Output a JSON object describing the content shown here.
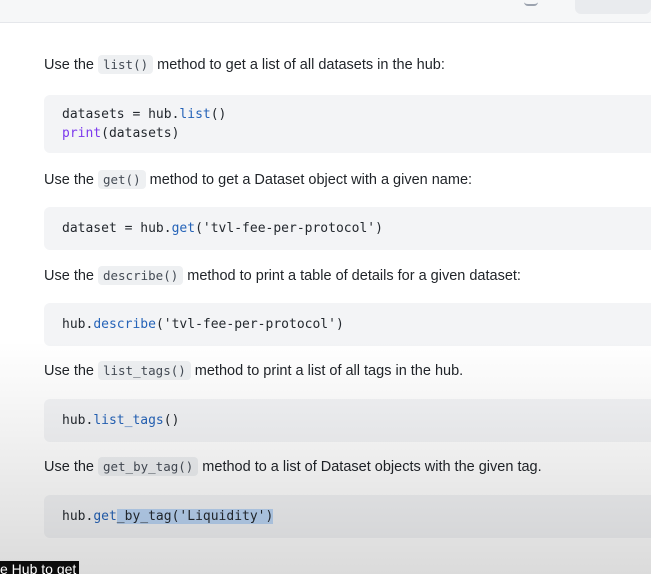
{
  "doc": {
    "sections": [
      {
        "before": "Use the",
        "method": "list()",
        "after": "method to get a list of all datasets in the hub:",
        "code_lines": [
          [
            "datasets",
            " = hub.",
            "list",
            "()"
          ],
          [
            "print",
            "(datasets)"
          ]
        ]
      },
      {
        "before": "Use the",
        "method": "get()",
        "after": "method to get a Dataset object with a given name:",
        "code": {
          "a": "dataset",
          "b": " = hub.",
          "c": "get",
          "d": "('tvl-fee-per-protocol')"
        }
      },
      {
        "before": "Use the",
        "method": "describe()",
        "after": "method to print a table of details for a given dataset:",
        "code": {
          "a": "hub.",
          "b": "describe",
          "c": "('tvl-fee-per-protocol')"
        }
      },
      {
        "before": "Use the",
        "method": "list_tags()",
        "after": "method to print a list of all tags in the hub.",
        "code": {
          "a": "hub.",
          "b": "list_tags",
          "c": "()"
        }
      },
      {
        "before": "Use the",
        "method": "get_by_tag()",
        "after": "method to a list of Dataset objects with the given tag.",
        "code": {
          "a": "hub.",
          "b": "get",
          "c": "_by_tag('Liquidity')"
        }
      }
    ]
  },
  "caption": {
    "text": "e Hub to get"
  }
}
